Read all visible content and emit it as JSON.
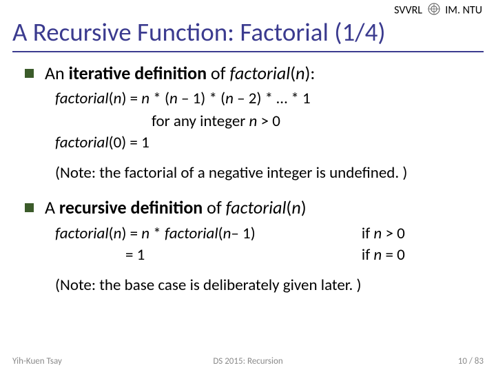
{
  "header": {
    "org_left": "SVVRL",
    "org_right": "IM. NTU"
  },
  "title": "A Recursive Function: Factorial (1/4)",
  "bullet1": {
    "pre": "An ",
    "bold": "iterative definition",
    "mid": " of ",
    "ital": "factorial",
    "paren": "(",
    "n": "n",
    "close": "):"
  },
  "iter": {
    "line1_a": "factorial",
    "line1_b": "(",
    "line1_c": "n",
    "line1_d": ") = ",
    "line1_e": "n",
    "line1_f": " * (",
    "line1_g": "n",
    "line1_h": " – 1) * (",
    "line1_i": "n",
    "line1_j": " – 2) * … * 1",
    "line2_a": "for any integer ",
    "line2_b": "n",
    "line2_c": " > 0",
    "line3_a": "factorial",
    "line3_b": "(0) = 1"
  },
  "note1": "(Note: the factorial of a negative integer is undefined. )",
  "bullet2": {
    "pre": "A ",
    "bold": "recursive definition",
    "mid": " of ",
    "ital": "factorial",
    "paren": "(",
    "n": "n",
    "close": ")"
  },
  "rec": {
    "l1_a": "factorial",
    "l1_b": "(",
    "l1_c": "n",
    "l1_d": ") = ",
    "l1_e": "n",
    "l1_f": " * ",
    "l1_g": "factorial",
    "l1_h": "(",
    "l1_i": "n",
    "l1_j": "– 1)",
    "r1_a": "if ",
    "r1_b": "n",
    "r1_c": " > 0",
    "l2": "= 1",
    "r2_a": "if ",
    "r2_b": "n",
    "r2_c": " = 0"
  },
  "note2": "(Note: the base case is deliberately given later. )",
  "footer": {
    "left": "Yih-Kuen Tsay",
    "center": "DS 2015: Recursion",
    "right": "10 / 83"
  }
}
